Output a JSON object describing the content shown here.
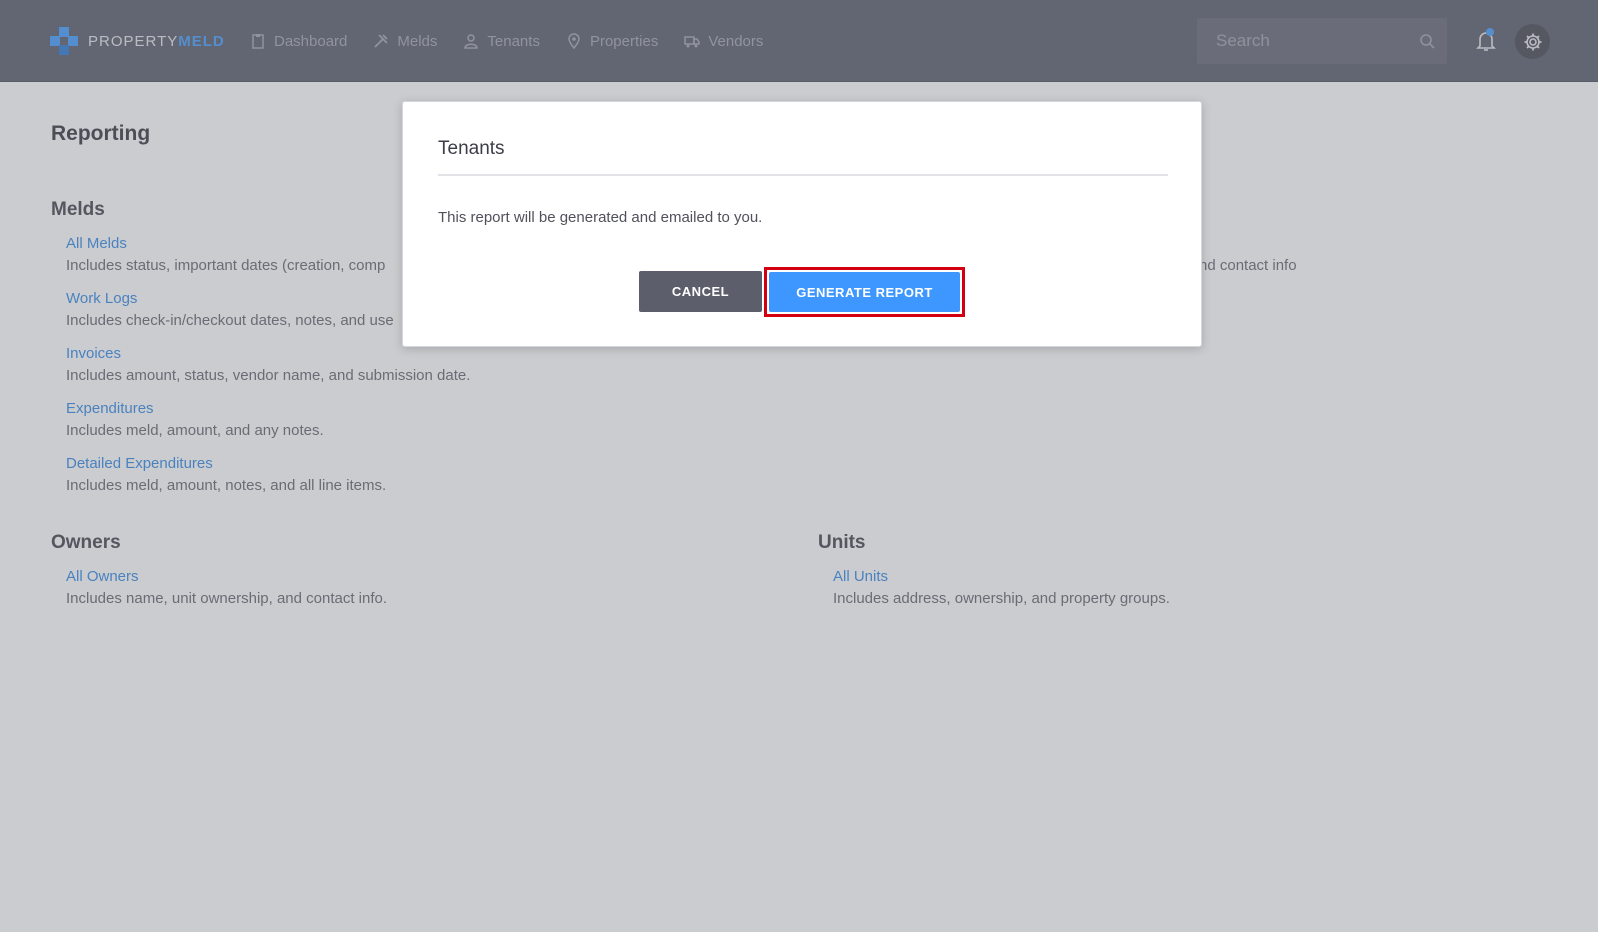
{
  "app": {
    "logo_part1": "PROPERTY",
    "logo_part2": "MELD",
    "brand_color": "#4aa0ff"
  },
  "nav": {
    "items": [
      {
        "label": "Dashboard",
        "icon": "clipboard-icon"
      },
      {
        "label": "Melds",
        "icon": "tools-icon"
      },
      {
        "label": "Tenants",
        "icon": "person-icon"
      },
      {
        "label": "Properties",
        "icon": "map-pin-icon"
      },
      {
        "label": "Vendors",
        "icon": "truck-icon"
      }
    ]
  },
  "search": {
    "placeholder": "Search"
  },
  "page": {
    "title": "Reporting",
    "sections": {
      "melds": {
        "title": "Melds",
        "reports": [
          {
            "label": "All Melds",
            "desc": "Includes status, important dates (creation, comp"
          },
          {
            "label": "Work Logs",
            "desc": "Includes check-in/checkout dates, notes, and use"
          },
          {
            "label": "Invoices",
            "desc": "Includes amount, status, vendor name, and submission date."
          },
          {
            "label": "Expenditures",
            "desc": "Includes meld, amount, and any notes."
          },
          {
            "label": "Detailed Expenditures",
            "desc": "Includes meld, amount, notes, and all line items."
          }
        ]
      },
      "right_fragment": "nd contact info",
      "owners": {
        "title": "Owners",
        "reports": [
          {
            "label": "All Owners",
            "desc": "Includes name, unit ownership, and contact info."
          }
        ]
      },
      "units": {
        "title": "Units",
        "reports": [
          {
            "label": "All Units",
            "desc": "Includes address, ownership, and property groups."
          }
        ]
      }
    }
  },
  "modal": {
    "title": "Tenants",
    "body": "This report will be generated and emailed to you.",
    "cancel_label": "CANCEL",
    "generate_label": "GENERATE REPORT"
  }
}
